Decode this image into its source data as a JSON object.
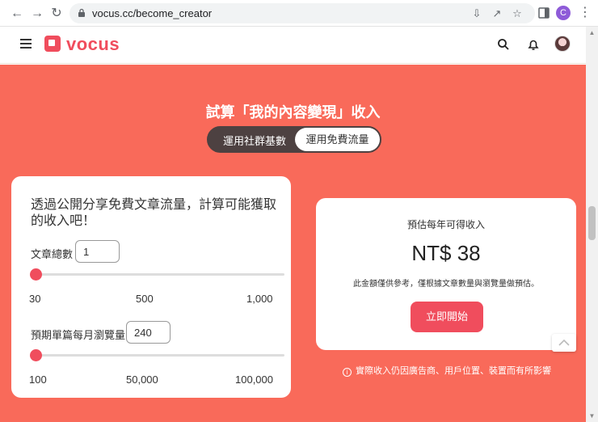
{
  "browser": {
    "url": "vocus.cc/become_creator",
    "profile_initial": "C"
  },
  "site": {
    "brand": "vocus"
  },
  "hero": {
    "title": "試算「我的內容變現」收入",
    "toggle_left": "運用社群基數",
    "toggle_right": "運用免費流量"
  },
  "calculator": {
    "heading": "透過公開分享免費文章流量，計算可能獲取的收入吧！",
    "articles": {
      "label": "文章總數",
      "value": "1",
      "slider_fraction": 0.0,
      "ticks": [
        "30",
        "500",
        "1,000"
      ]
    },
    "views": {
      "label": "預期單篇每月瀏覽量",
      "value": "240",
      "slider_fraction": 0.0,
      "ticks": [
        "100",
        "50,000",
        "100,000"
      ]
    }
  },
  "result": {
    "label": "預估每年可得收入",
    "amount": "NT$ 38",
    "note": "此金額僅供參考，僅根據文章數量與瀏覽量做預估。",
    "button": "立即開始"
  },
  "disclaimer": "實際收入仍因廣告商、用戶位置、裝置而有所影響",
  "colors": {
    "brand": "#f04d5d",
    "hero_bg": "#f96a5a",
    "toggle_bg": "#4d4141"
  }
}
